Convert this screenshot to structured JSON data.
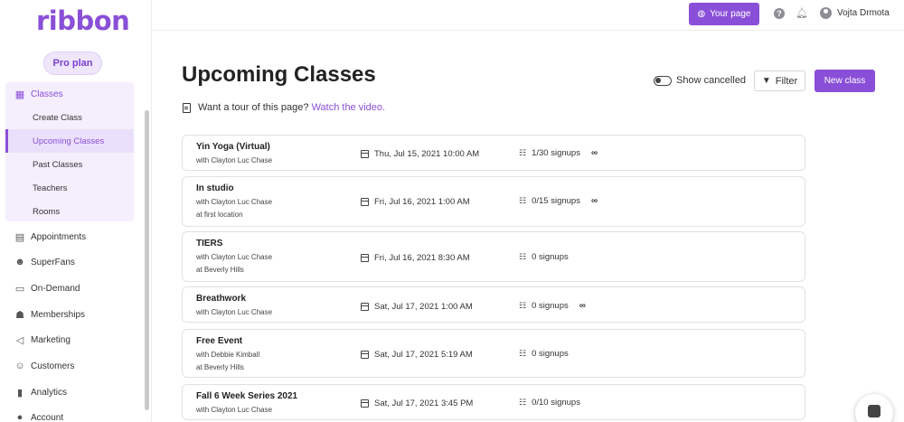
{
  "sidebar": {
    "logo": "ribbon",
    "plan": "Pro plan",
    "items": [
      {
        "label": "Classes",
        "icon": "calendar-icon"
      },
      {
        "label": "Appointments",
        "icon": "calendar-grid-icon"
      },
      {
        "label": "SuperFans",
        "icon": "users-icon"
      },
      {
        "label": "On-Demand",
        "icon": "video-icon"
      },
      {
        "label": "Memberships",
        "icon": "members-icon"
      },
      {
        "label": "Marketing",
        "icon": "megaphone-icon"
      },
      {
        "label": "Customers",
        "icon": "customers-icon"
      },
      {
        "label": "Analytics",
        "icon": "bar-chart-icon"
      },
      {
        "label": "Account",
        "icon": "account-icon"
      }
    ],
    "sub_items": [
      "Create Class",
      "Upcoming Classes",
      "Past Classes",
      "Teachers",
      "Rooms"
    ]
  },
  "topbar": {
    "your_page": "Your page",
    "help": "?",
    "user_name": "Vojta Drmota"
  },
  "main": {
    "title": "Upcoming Classes",
    "show_cancelled": "Show cancelled",
    "filter": "Filter",
    "new_class": "New class",
    "tour_text": "Want a tour of this page?",
    "tour_link": "Watch the video."
  },
  "classes": [
    {
      "name": "Yin Yoga (Virtual)",
      "teacher": "with Clayton Luc Chase",
      "location": "",
      "date": "Thu, Jul 15, 2021 10:00 AM",
      "signups": "1/30 signups",
      "infinity": "∞"
    },
    {
      "name": "In studio",
      "teacher": "with Clayton Luc Chase",
      "location": "at first location",
      "date": "Fri, Jul 16, 2021 1:00 AM",
      "signups": "0/15 signups",
      "infinity": "∞"
    },
    {
      "name": "TIERS",
      "teacher": "with Clayton Luc Chase",
      "location": "at Beverly Hills",
      "date": "Fri, Jul 16, 2021 8:30 AM",
      "signups": "0 signups",
      "infinity": ""
    },
    {
      "name": "Breathwork",
      "teacher": "with Clayton Luc Chase",
      "location": "",
      "date": "Sat, Jul 17, 2021 1:00 AM",
      "signups": "0 signups",
      "infinity": "∞"
    },
    {
      "name": "Free Event",
      "teacher": "with Debbie Kimball",
      "location": "at Beverly Hills",
      "date": "Sat, Jul 17, 2021 5:19 AM",
      "signups": "0 signups",
      "infinity": ""
    },
    {
      "name": "Fall 6 Week Series 2021",
      "teacher": "with Clayton Luc Chase",
      "location": "",
      "date": "Sat, Jul 17, 2021 3:45 PM",
      "signups": "0/10 signups",
      "infinity": ""
    }
  ],
  "colors": {
    "accent": "#8a4fd8",
    "accent_light": "#f5effd"
  }
}
